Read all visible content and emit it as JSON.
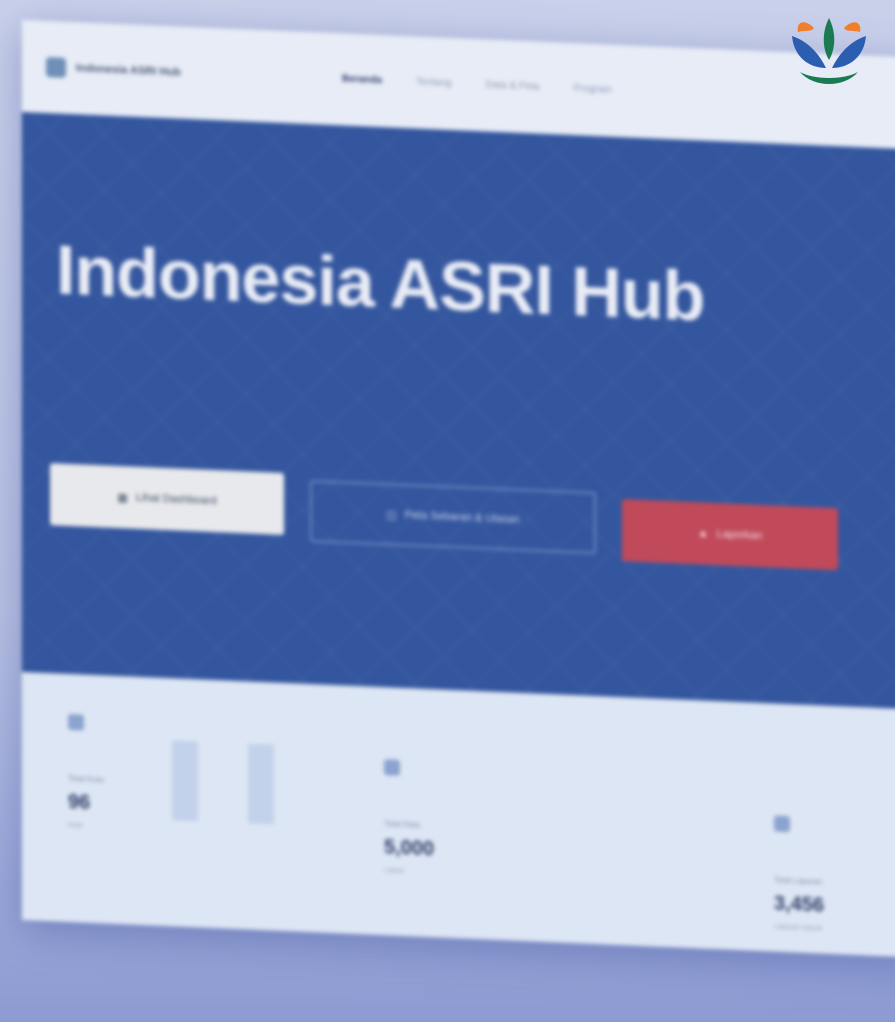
{
  "navbar": {
    "brand_text": "Indonesia ASRI Hub",
    "links": [
      "Beranda",
      "Tentang",
      "Data & Peta",
      "Program"
    ]
  },
  "hero": {
    "title": "Indonesia ASRI Hub",
    "buttons": {
      "primary": "Lihat Dashboard",
      "outline": "Peta Sebaran & Ulasan",
      "red": "Laporkan"
    }
  },
  "stats": [
    {
      "label": "Total Kota",
      "value": "96",
      "sub": "Kota"
    },
    {
      "label": "Total Data",
      "value": "5,000",
      "sub": "Lokasi"
    },
    {
      "label": "Total Laporan",
      "value": "3,456",
      "sub": "Laporan masuk"
    }
  ],
  "colors": {
    "hero_blue": "#34569e",
    "report_red": "#c04a5a",
    "logo_orange": "#ef7f2a",
    "logo_blue": "#2b5db0",
    "logo_green": "#1a7a52"
  },
  "icons": [
    "brand-icon",
    "dashboard-icon",
    "map-icon",
    "upload-icon",
    "city-icon",
    "data-icon",
    "report-icon"
  ]
}
